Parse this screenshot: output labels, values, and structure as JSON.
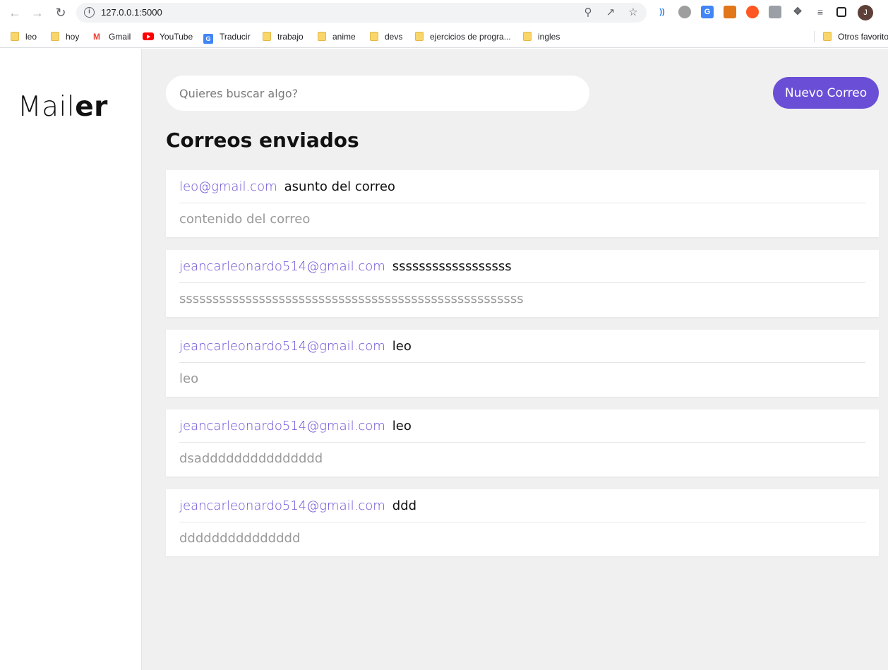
{
  "browser": {
    "url": "127.0.0.1:5000",
    "profile_initial": "J",
    "bookmarks": [
      {
        "label": "leo",
        "type": "folder"
      },
      {
        "label": "hoy",
        "type": "folder"
      },
      {
        "label": "Gmail",
        "type": "gmail"
      },
      {
        "label": "YouTube",
        "type": "youtube"
      },
      {
        "label": "Traducir",
        "type": "translate"
      },
      {
        "label": "trabajo",
        "type": "folder"
      },
      {
        "label": "anime",
        "type": "folder"
      },
      {
        "label": "devs",
        "type": "folder"
      },
      {
        "label": "ejercicios de progra...",
        "type": "folder"
      },
      {
        "label": "ingles",
        "type": "folder"
      }
    ],
    "other_bookmarks": "Otros favorito"
  },
  "app": {
    "logo_light": "Mail",
    "logo_bold": "er",
    "search_placeholder": "Quieres buscar algo?",
    "new_button": "Nuevo Correo",
    "section_title": "Correos enviados",
    "accent_color": "#6a4fd6"
  },
  "emails": [
    {
      "to": "leo@gmail.com",
      "subject": "asunto del correo",
      "body": "contenido del correo"
    },
    {
      "to": "jeancarleonardo514@gmail.com",
      "subject": "ssssssssssssssssss",
      "body": "ssssssssssssssssssssssssssssssssssssssssssssssssssss"
    },
    {
      "to": "jeancarleonardo514@gmail.com",
      "subject": "leo",
      "body": "leo"
    },
    {
      "to": "jeancarleonardo514@gmail.com",
      "subject": "leo",
      "body": "dsaddddddddddddddd"
    },
    {
      "to": "jeancarleonardo514@gmail.com",
      "subject": "ddd",
      "body": "ddddddddddddddd"
    }
  ]
}
